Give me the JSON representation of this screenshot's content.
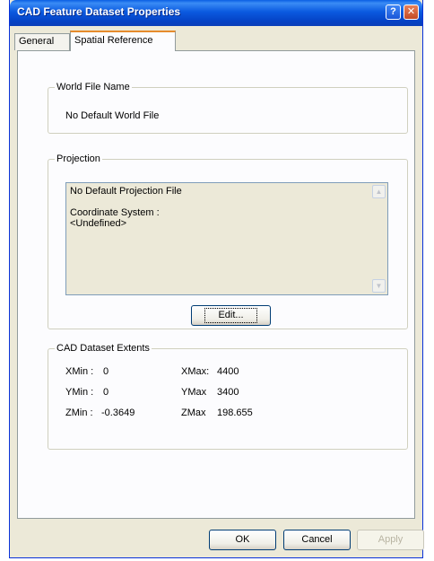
{
  "window": {
    "title": "CAD Feature Dataset Properties"
  },
  "titlebar_buttons": {
    "help": "?",
    "close": "✕"
  },
  "tabs": [
    {
      "label": "General"
    },
    {
      "label": "Spatial Reference",
      "selected": true
    }
  ],
  "world_file": {
    "legend": "World File Name",
    "value": "No Default World File"
  },
  "projection": {
    "legend": "Projection",
    "text_line1": "No Default Projection File",
    "text_line2": "Coordinate System :",
    "text_line3": "<Undefined>",
    "edit_label": "Edit..."
  },
  "extents": {
    "legend": "CAD Dataset Extents",
    "xmin_label": "XMin :",
    "xmin_value": "0",
    "ymin_label": "YMin :",
    "ymin_value": "0",
    "zmin_label": "ZMin :",
    "zmin_value": "-0.3649",
    "xmax_label": "XMax:",
    "xmax_value": "4400",
    "ymax_label": "YMax",
    "ymax_value": "3400",
    "zmax_label": "ZMax",
    "zmax_value": "198.655"
  },
  "footer": {
    "ok_label": "OK",
    "cancel_label": "Cancel",
    "apply_label": "Apply"
  },
  "colors": {
    "titlebar": "#0a5ee3",
    "dialog_bg": "#ece9d8",
    "tab_highlight": "#e68b2c"
  }
}
